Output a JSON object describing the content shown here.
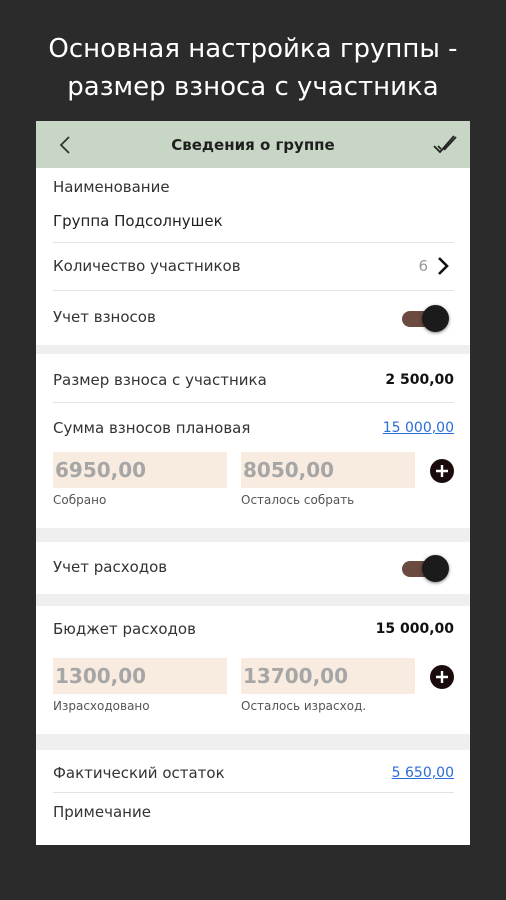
{
  "promo": {
    "line1": "Основная настройка группы -",
    "line2": "размер взноса с участника"
  },
  "appbar": {
    "title": "Сведения о группе"
  },
  "group": {
    "name_label": "Наименование",
    "name_value": "Группа Подсолнушек",
    "members_label": "Количество участников",
    "members_value": "6",
    "contributions_label": "Учет взносов",
    "contributions_enabled": true
  },
  "contributions": {
    "per_member_label": "Размер взноса с участника",
    "per_member_value": "2 500,00",
    "planned_label": "Сумма взносов плановая",
    "planned_value": "15 000,00",
    "collected_value": "6950,00",
    "collected_label": "Собрано",
    "remaining_value": "8050,00",
    "remaining_label": "Осталось собрать"
  },
  "expenses": {
    "label": "Учет расходов",
    "enabled": true,
    "budget_label": "Бюджет расходов",
    "budget_value": "15 000,00",
    "spent_value": "1300,00",
    "spent_label": "Израсходовано",
    "remaining_value": "13700,00",
    "remaining_label": "Осталось израсход."
  },
  "balance": {
    "actual_label": "Фактический остаток",
    "actual_value": "5 650,00",
    "note_label": "Примечание"
  },
  "colors": {
    "appbar": "#c8d7c5",
    "toggle_track": "#6b4a40",
    "input_bg": "#f8ebdf",
    "link": "#2a6dd6"
  }
}
